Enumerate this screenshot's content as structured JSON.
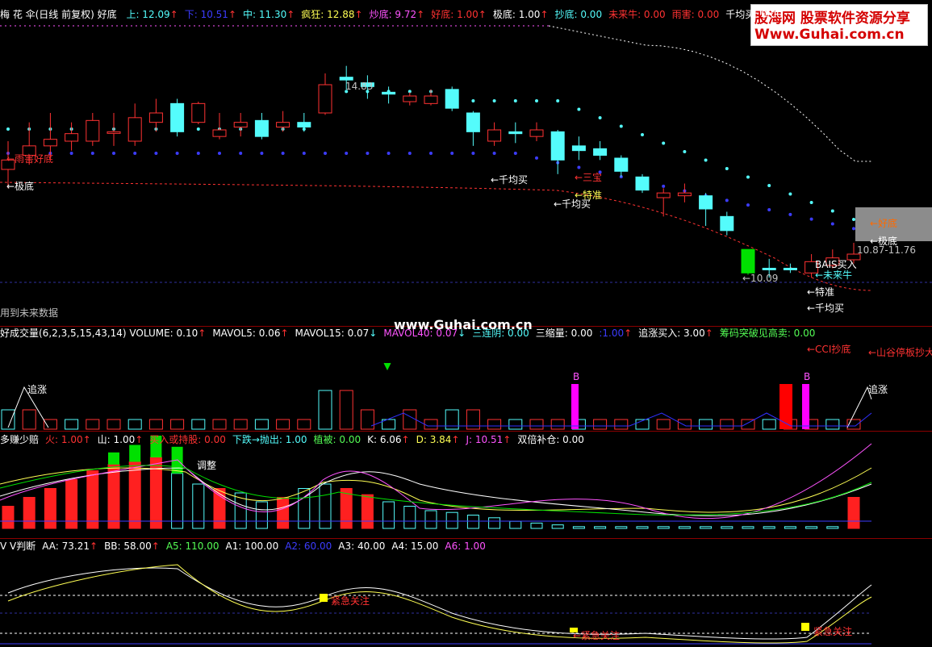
{
  "colors": {
    "up": "#ff3232",
    "down": "#54fcfc",
    "blue": "#3c3cff",
    "yellow": "#ffff54",
    "white": "#ffffff",
    "magenta": "#ff54ff",
    "green": "#00e000",
    "gray": "#c0c0c0"
  },
  "panel1": {
    "title": "梅 花 伞(日线 前复权) 好底",
    "indicators": [
      {
        "text": "上: 12.09",
        "color": "#54fcfc",
        "arrow": "↑"
      },
      {
        "text": "下: 10.51",
        "color": "#3c3cff",
        "arrow": "↑"
      },
      {
        "text": "中: 11.30",
        "color": "#54fcfc",
        "arrow": "↑"
      },
      {
        "text": "疯狂: 12.88",
        "color": "#ffff54",
        "arrow": "↑"
      },
      {
        "text": "炒底: 9.72",
        "color": "#ff54ff",
        "arrow": "↑"
      },
      {
        "text": "好底: 1.00",
        "color": "#ff3232",
        "arrow": "↑"
      },
      {
        "text": "极底: 1.00",
        "color": "#ffffff",
        "arrow": "↑"
      },
      {
        "text": "抄底: 0.00",
        "color": "#54fcfc",
        "arrow": ""
      },
      {
        "text": "未来牛: 0.00",
        "color": "#ff3232",
        "arrow": ""
      },
      {
        "text": "雨害: 0.00",
        "color": "#ff3232",
        "arrow": ""
      },
      {
        "text": "千均买: 0.00",
        "color": "#ffffff",
        "arrow": ""
      }
    ],
    "labels": [
      {
        "text": "←雨害好底",
        "color": "#ff3232"
      },
      {
        "text": "←极底",
        "color": "#ffffff"
      },
      {
        "text": "←千均买",
        "color": "#ffffff"
      },
      {
        "text": "←三宝",
        "color": "#ff3232"
      },
      {
        "text": "←特准",
        "color": "#ffff54"
      },
      {
        "text": "←千均买",
        "color": "#ffffff"
      },
      {
        "text": "←好底",
        "color": "#ff6a00"
      },
      {
        "text": "←极底",
        "color": "#ffffff"
      },
      {
        "text": "BAIS买入",
        "color": "#ffffff"
      },
      {
        "text": "←未来牛",
        "color": "#54fcfc"
      },
      {
        "text": "←特准",
        "color": "#ffffff"
      },
      {
        "text": "←千均买",
        "color": "#ffffff"
      },
      {
        "text": "14.83",
        "color": "#c0c0c0"
      },
      {
        "text": "←10.09",
        "color": "#c0c0c0"
      },
      {
        "text": "10.87-11.76",
        "color": "#c0c0c0"
      },
      {
        "text": "用到未来数据",
        "color": "#c0c0c0"
      }
    ]
  },
  "watermark": "www.Guhai.com.cn",
  "logo": {
    "line1": "股海网 股票软件资源分享",
    "line2": "Www.Guhai.com.cn"
  },
  "panel2": {
    "indicators": [
      {
        "text": "好成交量(6,2,3,5,15,43,14) VOLUME: 0.10",
        "color": "#ffffff",
        "arrow": "↑"
      },
      {
        "text": "MAVOL5: 0.06",
        "color": "#ffffff",
        "arrow": "↑"
      },
      {
        "text": "MAVOL15: 0.07",
        "color": "#ffffff",
        "arrow": "↓"
      },
      {
        "text": "MAVOL40: 0.07",
        "color": "#ff54ff",
        "arrow": "↓"
      },
      {
        "text": "三连阴: 0.00",
        "color": "#54fcfc",
        "arrow": ""
      },
      {
        "text": "三缩量: 0.00",
        "color": "#ffffff",
        "arrow": ""
      },
      {
        "text": ":1.00",
        "color": "#3c3cff",
        "arrow": "↑"
      },
      {
        "text": "追涨买入: 3.00",
        "color": "#ffffff",
        "arrow": "↑"
      },
      {
        "text": "筹码突破见高卖: 0.00",
        "color": "#54fc54",
        "arrow": ""
      }
    ],
    "labels": [
      {
        "text": "←CCI抄底",
        "color": "#ff3232"
      },
      {
        "text": "←山谷停板抄大",
        "color": "#ff3232"
      },
      {
        "text": "追涨",
        "color": "#ffffff"
      },
      {
        "text": "追涨",
        "color": "#ffffff"
      },
      {
        "text": "B",
        "color": "#ff54ff"
      },
      {
        "text": "B",
        "color": "#ff54ff"
      }
    ]
  },
  "panel3": {
    "indicators": [
      {
        "text": "多赚少赔",
        "color": "#ffffff",
        "arrow": ""
      },
      {
        "text": "火: 1.00",
        "color": "#ff3232",
        "arrow": "↑"
      },
      {
        "text": "山: 1.00",
        "color": "#ffffff",
        "arrow": "↑"
      },
      {
        "text": "买入或持股: 0.00",
        "color": "#ff3232",
        "arrow": ""
      },
      {
        "text": "下跌→抛出: 1.00",
        "color": "#54fcfc",
        "arrow": ""
      },
      {
        "text": "植被: 0.00",
        "color": "#54fc54",
        "arrow": ""
      },
      {
        "text": "K: 6.06",
        "color": "#ffffff",
        "arrow": "↑"
      },
      {
        "text": "D: 3.84",
        "color": "#ffff54",
        "arrow": "↑"
      },
      {
        "text": "J: 10.51",
        "color": "#ff54ff",
        "arrow": "↑"
      },
      {
        "text": "双倍补仓: 0.00",
        "color": "#ffffff",
        "arrow": ""
      }
    ],
    "labels": [
      {
        "text": "调整",
        "color": "#ffffff"
      }
    ]
  },
  "panel4": {
    "indicators": [
      {
        "text": "V V判断",
        "color": "#ffffff",
        "arrow": ""
      },
      {
        "text": "AA: 73.21",
        "color": "#ffffff",
        "arrow": "↑"
      },
      {
        "text": "BB: 58.00",
        "color": "#ffffff",
        "arrow": "↑"
      },
      {
        "text": "A5: 110.00",
        "color": "#54fc54",
        "arrow": ""
      },
      {
        "text": "A1: 100.00",
        "color": "#ffffff",
        "arrow": ""
      },
      {
        "text": "A2: 60.00",
        "color": "#3c3cff",
        "arrow": ""
      },
      {
        "text": "A3: 40.00",
        "color": "#ffffff",
        "arrow": ""
      },
      {
        "text": "A4: 15.00",
        "color": "#ffffff",
        "arrow": ""
      },
      {
        "text": "A6: 1.00",
        "color": "#ff54ff",
        "arrow": ""
      }
    ],
    "labels": [
      {
        "text": "紧急关注",
        "color": "#ff3232"
      },
      {
        "text": "←紧急关注",
        "color": "#ff3232"
      },
      {
        "text": "紧急关注",
        "color": "#ff3232"
      }
    ]
  },
  "candles": [
    {
      "o": 11.1,
      "c": 11.2,
      "h": 11.4,
      "l": 10.9
    },
    {
      "o": 11.25,
      "c": 11.35,
      "h": 11.6,
      "l": 11.15
    },
    {
      "o": 11.35,
      "c": 11.42,
      "h": 11.7,
      "l": 11.2
    },
    {
      "o": 11.4,
      "c": 11.48,
      "h": 11.6,
      "l": 11.3
    },
    {
      "o": 11.4,
      "c": 11.62,
      "h": 11.7,
      "l": 11.35
    },
    {
      "o": 11.5,
      "c": 11.5,
      "h": 11.7,
      "l": 11.35
    },
    {
      "o": 11.4,
      "c": 11.65,
      "h": 11.8,
      "l": 11.35
    },
    {
      "o": 11.6,
      "c": 11.7,
      "h": 11.85,
      "l": 11.5
    },
    {
      "o": 11.5,
      "c": 11.8,
      "h": 11.85,
      "l": 11.45
    },
    {
      "o": 11.8,
      "c": 11.6,
      "h": 11.82,
      "l": 11.58
    },
    {
      "o": 11.45,
      "c": 11.52,
      "h": 11.7,
      "l": 11.42
    },
    {
      "o": 11.55,
      "c": 11.6,
      "h": 11.7,
      "l": 11.45
    },
    {
      "o": 11.45,
      "c": 11.62,
      "h": 11.7,
      "l": 11.42
    },
    {
      "o": 11.6,
      "c": 11.55,
      "h": 11.72,
      "l": 11.5
    },
    {
      "o": 11.55,
      "c": 11.6,
      "h": 11.7,
      "l": 11.5
    },
    {
      "o": 11.7,
      "c": 12.0,
      "h": 12.12,
      "l": 11.68
    },
    {
      "o": 12.05,
      "c": 12.08,
      "h": 12.2,
      "l": 11.95
    },
    {
      "o": 12.02,
      "c": 11.98,
      "h": 12.1,
      "l": 11.85
    },
    {
      "o": 11.92,
      "c": 11.9,
      "h": 11.98,
      "l": 11.8
    },
    {
      "o": 11.88,
      "c": 11.82,
      "h": 11.92,
      "l": 11.78
    },
    {
      "o": 11.8,
      "c": 11.88,
      "h": 11.95,
      "l": 11.78
    },
    {
      "o": 11.95,
      "c": 11.75,
      "h": 11.98,
      "l": 11.72
    },
    {
      "o": 11.7,
      "c": 11.5,
      "h": 11.72,
      "l": 11.35
    },
    {
      "o": 11.4,
      "c": 11.52,
      "h": 11.6,
      "l": 11.35
    },
    {
      "o": 11.5,
      "c": 11.48,
      "h": 11.6,
      "l": 11.38
    },
    {
      "o": 11.45,
      "c": 11.52,
      "h": 11.6,
      "l": 11.4
    },
    {
      "o": 11.5,
      "c": 11.2,
      "h": 11.52,
      "l": 11.05
    },
    {
      "o": 11.3,
      "c": 11.35,
      "h": 11.45,
      "l": 11.2
    },
    {
      "o": 11.32,
      "c": 11.25,
      "h": 11.4,
      "l": 11.2
    },
    {
      "o": 11.22,
      "c": 11.08,
      "h": 11.25,
      "l": 11.02
    },
    {
      "o": 11.02,
      "c": 10.88,
      "h": 11.05,
      "l": 10.85
    },
    {
      "o": 10.8,
      "c": 10.85,
      "h": 10.9,
      "l": 10.6
    },
    {
      "o": 10.85,
      "c": 10.82,
      "h": 10.95,
      "l": 10.75
    },
    {
      "o": 10.82,
      "c": 10.68,
      "h": 10.85,
      "l": 10.5
    },
    {
      "o": 10.6,
      "c": 10.45,
      "h": 10.65,
      "l": 10.4
    },
    {
      "o": 10.25,
      "c": 10.0,
      "h": 10.25,
      "l": 9.98
    },
    {
      "o": 10.05,
      "c": 10.05,
      "h": 10.15,
      "l": 9.95
    },
    {
      "o": 10.05,
      "c": 10.05,
      "h": 10.1,
      "l": 10.0
    },
    {
      "o": 10.0,
      "c": 10.12,
      "h": 10.2,
      "l": 9.95
    },
    {
      "o": 10.08,
      "c": 10.16,
      "h": 10.25,
      "l": 10.05
    },
    {
      "o": 10.14,
      "c": 10.2,
      "h": 10.32,
      "l": 10.1
    }
  ],
  "candle_colors": [
    "up",
    "up",
    "up",
    "up",
    "up",
    "up",
    "up",
    "up",
    "down",
    "up",
    "up",
    "up",
    "down",
    "up",
    "down",
    "up",
    "down",
    "down",
    "down",
    "up",
    "up",
    "down",
    "down",
    "up",
    "down",
    "up",
    "down",
    "down",
    "down",
    "down",
    "down",
    "up",
    "up",
    "down",
    "down",
    "green",
    "down",
    "down",
    "up",
    "up",
    "up"
  ],
  "volumes": [
    0.02,
    0.02,
    0.01,
    0.01,
    0.01,
    0.01,
    0.01,
    0.01,
    0.01,
    0.01,
    0.01,
    0.01,
    0.01,
    0.01,
    0.01,
    0.04,
    0.04,
    0.02,
    0.01,
    0.02,
    0.01,
    0.02,
    0.02,
    0.01,
    0.01,
    0.01,
    0.01,
    0.01,
    0.01,
    0.01,
    0.01,
    0.01,
    0.01,
    0.01,
    0.01,
    0.01,
    0.01,
    0.01,
    0.01,
    0.01,
    0.01
  ],
  "duozhuan_bars": [
    0.25,
    0.35,
    0.45,
    0.55,
    0.65,
    0.72,
    0.75,
    0.8,
    0.62,
    0.5,
    0.45,
    0.4,
    0.3,
    0.35,
    0.45,
    0.5,
    0.45,
    0.38,
    0.3,
    0.25,
    0.2,
    0.18,
    0.15,
    0.12,
    0.08,
    0.06,
    0.04,
    0.02,
    0.02,
    0.02,
    0.02,
    0.02,
    0.02,
    0.02,
    0.02,
    0.02,
    0.02,
    0.02,
    0.02,
    0.02,
    0.35
  ]
}
